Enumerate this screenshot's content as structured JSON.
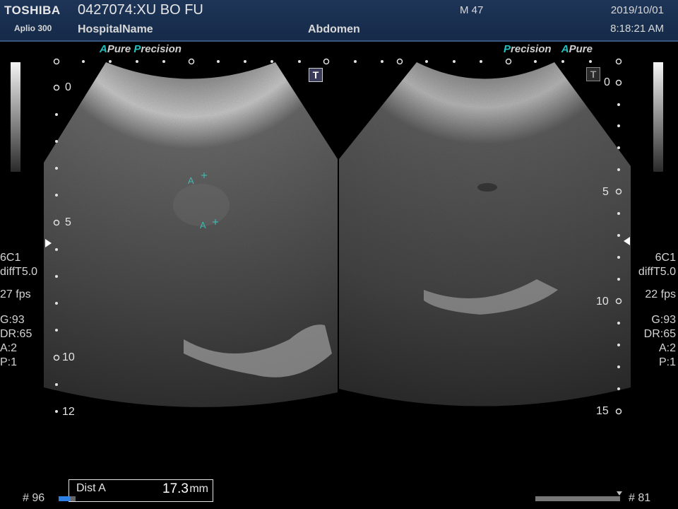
{
  "header": {
    "brand": "TOSHIBA",
    "model": "Aplio 300",
    "patient": "0427074:XU BO FU",
    "hospital": "HospitalName",
    "exam": "Abdomen",
    "mi": "M 47",
    "date": "2019/10/01",
    "time": "8:18:21 AM",
    "background_color": "#1a3050"
  },
  "left_panel": {
    "logo_a": "A",
    "logo_pure": "Pure",
    "logo_p": "P",
    "logo_precision": "recision",
    "depth_ticks": [
      "0",
      "5",
      "10",
      "12"
    ],
    "info": [
      "6C1",
      "diffT5.0",
      "27 fps",
      "G:93",
      "DR:65",
      "A:2",
      "P:1"
    ],
    "markers": [
      "A",
      "A"
    ],
    "frame": "# 96",
    "progress": 0.7
  },
  "right_panel": {
    "logo_p": "P",
    "logo_precision": "recision",
    "logo_a": "A",
    "logo_pure": "Pure",
    "depth_ticks": [
      "0",
      "5",
      "10",
      "15"
    ],
    "info": [
      "6C1",
      "diffT5.0",
      "22 fps",
      "G:93",
      "DR:65",
      "A:2",
      "P:1"
    ],
    "frame": "# 81",
    "progress": 1.0
  },
  "measurement": {
    "label": "Dist A",
    "value": "17.3",
    "unit": "mm"
  },
  "icons": {
    "t_marker_left": "T",
    "t_marker_right": "T"
  },
  "colors": {
    "accent_cyan": "#24c0c0",
    "caliper": "#3fb8b0",
    "progress_blue": "#2e80e6"
  }
}
